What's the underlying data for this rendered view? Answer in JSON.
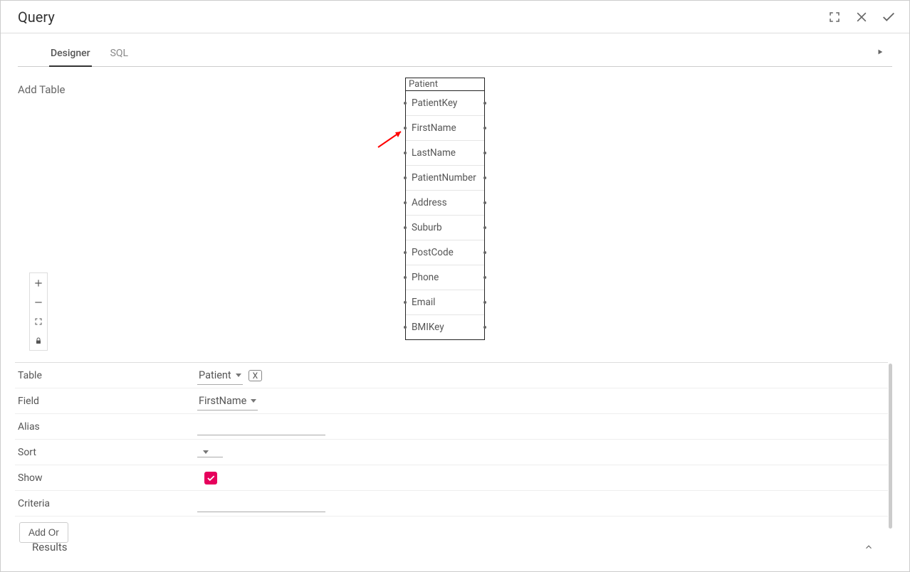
{
  "header": {
    "title": "Query"
  },
  "tabs": {
    "designer": "Designer",
    "sql": "SQL"
  },
  "designer": {
    "add_table": "Add Table"
  },
  "table": {
    "name": "Patient",
    "columns": [
      "PatientKey",
      "FirstName",
      "LastName",
      "PatientNumber",
      "Address",
      "Suburb",
      "PostCode",
      "Phone",
      "Email",
      "BMIKey"
    ]
  },
  "fields": {
    "labels": {
      "table": "Table",
      "field": "Field",
      "alias": "Alias",
      "sort": "Sort",
      "show": "Show",
      "criteria": "Criteria",
      "add_or": "Add Or"
    },
    "values": {
      "table": "Patient",
      "field": "FirstName",
      "alias": "",
      "sort": "",
      "show": true,
      "criteria": "",
      "x_label": "X"
    }
  },
  "results": {
    "label": "Results"
  }
}
